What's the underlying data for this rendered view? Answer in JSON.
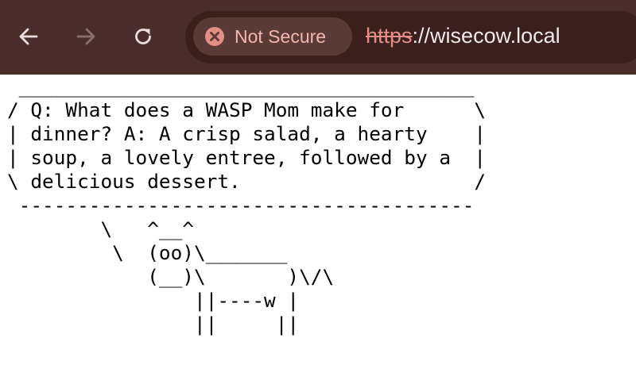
{
  "browser": {
    "nav": {
      "back_icon": "arrow-left-icon",
      "forward_icon": "arrow-right-icon",
      "reload_icon": "reload-icon"
    },
    "security_chip": {
      "icon": "warning-x-circle-icon",
      "label": "Not Secure"
    },
    "url": {
      "scheme": "https",
      "rest": "://wisecow.local"
    },
    "colors": {
      "toolbar_bg": "#4a2c2a",
      "omnibox_bg": "#3a1f1d",
      "chip_bg": "#5a3a37",
      "warning": "#e28f85"
    }
  },
  "page": {
    "cowsay": " _______________________________________\n/ Q: What does a WASP Mom make for      \\\n| dinner? A: A crisp salad, a hearty    |\n| soup, a lovely entree, followed by a  |\n\\ delicious dessert.                    /\n ---------------------------------------\n        \\   ^__^\n         \\  (oo)\\_______\n            (__)\\       )\\/\\\n                ||----w |\n                ||     ||"
  }
}
